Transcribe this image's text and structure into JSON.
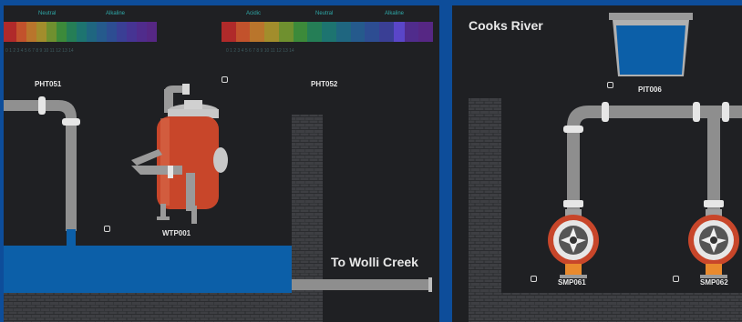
{
  "scale_left": {
    "headers": [
      "Neutral",
      "Alkaline"
    ],
    "numbers": "0   1   2   3   4   5   6   7   8   9   10  11  12  13  14"
  },
  "scale_right": {
    "headers": [
      "Acidic",
      "Neutral",
      "Alkaline"
    ],
    "numbers": "0   1   2   3   4   5   6   7   8   9   10  11  12  13  14"
  },
  "tags": {
    "pht051": "PHT051",
    "pht052": "PHT052",
    "wtp001": "WTP001",
    "pit006": "PIT006",
    "smp061": "SMP061",
    "smp062": "SMP062"
  },
  "labels": {
    "wolli": "To Wolli Creek",
    "cooks": "Cooks River"
  },
  "colors": {
    "water": "#0c5fa8",
    "pipe": "#9a9a9a",
    "tank": "#c8462a",
    "pump_ring": "#c8462a",
    "pump_accent": "#e98a2e",
    "brick": "#3e3f43",
    "panel": "#1f2023"
  }
}
